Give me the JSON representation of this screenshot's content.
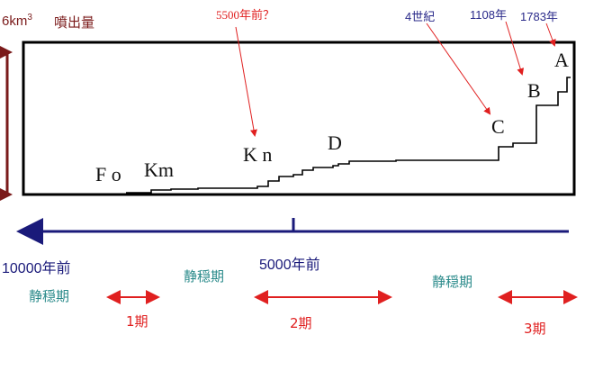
{
  "volume": {
    "scale_text": "6km",
    "scale_sup": "3",
    "title": "噴出量"
  },
  "annotations": {
    "kn_date": "5500年前？",
    "c_date": "4世紀",
    "b_date": "1108年",
    "a_date": "1783年"
  },
  "eruptions": [
    {
      "id": "fo",
      "label": "F o"
    },
    {
      "id": "km",
      "label": "Km"
    },
    {
      "id": "kn",
      "label": "K n"
    },
    {
      "id": "d",
      "label": "D"
    },
    {
      "id": "c",
      "label": "C"
    },
    {
      "id": "b",
      "label": "B"
    },
    {
      "id": "a",
      "label": "A"
    }
  ],
  "timeline": {
    "start_label": "10000年前",
    "mid_label": "5000年前"
  },
  "phases": {
    "quiet_1": "静穏期",
    "quiet_2": "静穏期",
    "quiet_3": "静穏期",
    "period_1": "1期",
    "period_2": "2期",
    "period_3": "3期"
  },
  "colors": {
    "volume_axis": "#7a1a1a",
    "timeline": "#1a1a7a",
    "pointer": "#e02020",
    "quiet_text": "#2a8a8a",
    "period": "#e02020",
    "frame": "#000000"
  }
}
